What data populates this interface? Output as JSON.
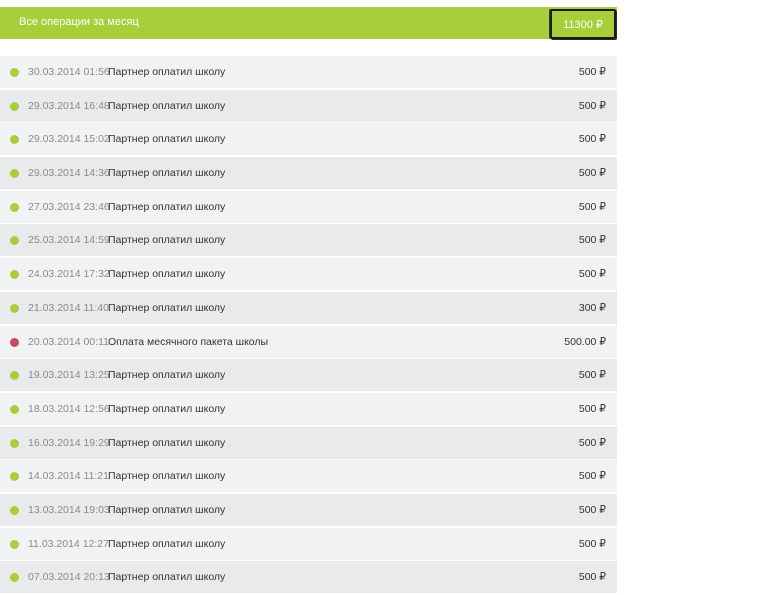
{
  "summary": {
    "title": "Все операции за месяц",
    "total": "11300 ₽"
  },
  "colors": {
    "accent": "#a7cf3a",
    "credit_dot": "#a7cf3a",
    "debit_dot": "#c8485e",
    "row_light": "#f1f2f4",
    "row_dark": "#e9eaec"
  },
  "transactions": [
    {
      "date": "30.03.2014 01:56",
      "description": "Партнер оплатил школу",
      "amount": "500 ₽",
      "type": "credit"
    },
    {
      "date": "29.03.2014 16:48",
      "description": "Партнер оплатил школу",
      "amount": "500 ₽",
      "type": "credit"
    },
    {
      "date": "29.03.2014 15:02",
      "description": "Партнер оплатил школу",
      "amount": "500 ₽",
      "type": "credit"
    },
    {
      "date": "29.03.2014 14:36",
      "description": "Партнер оплатил школу",
      "amount": "500 ₽",
      "type": "credit"
    },
    {
      "date": "27.03.2014 23:46",
      "description": "Партнер оплатил школу",
      "amount": "500 ₽",
      "type": "credit"
    },
    {
      "date": "25.03.2014 14:59",
      "description": "Партнер оплатил школу",
      "amount": "500 ₽",
      "type": "credit"
    },
    {
      "date": "24.03.2014 17:32",
      "description": "Партнер оплатил школу",
      "amount": "500 ₽",
      "type": "credit"
    },
    {
      "date": "21.03.2014 11:40",
      "description": "Партнер оплатил школу",
      "amount": "300 ₽",
      "type": "credit"
    },
    {
      "date": "20.03.2014 00:11",
      "description": "Оплата месячного пакета школы",
      "amount": "500.00 ₽",
      "type": "debit"
    },
    {
      "date": "19.03.2014 13:25",
      "description": "Партнер оплатил школу",
      "amount": "500 ₽",
      "type": "credit"
    },
    {
      "date": "18.03.2014 12:56",
      "description": "Партнер оплатил школу",
      "amount": "500 ₽",
      "type": "credit"
    },
    {
      "date": "16.03.2014 19:29",
      "description": "Партнер оплатил школу",
      "amount": "500 ₽",
      "type": "credit"
    },
    {
      "date": "14.03.2014 11:21",
      "description": "Партнер оплатил школу",
      "amount": "500 ₽",
      "type": "credit"
    },
    {
      "date": "13.03.2014 19:03",
      "description": "Партнер оплатил школу",
      "amount": "500 ₽",
      "type": "credit"
    },
    {
      "date": "11.03.2014 12:27",
      "description": "Партнер оплатил школу",
      "amount": "500 ₽",
      "type": "credit"
    },
    {
      "date": "07.03.2014 20:13",
      "description": "Партнер оплатил школу",
      "amount": "500 ₽",
      "type": "credit"
    }
  ]
}
